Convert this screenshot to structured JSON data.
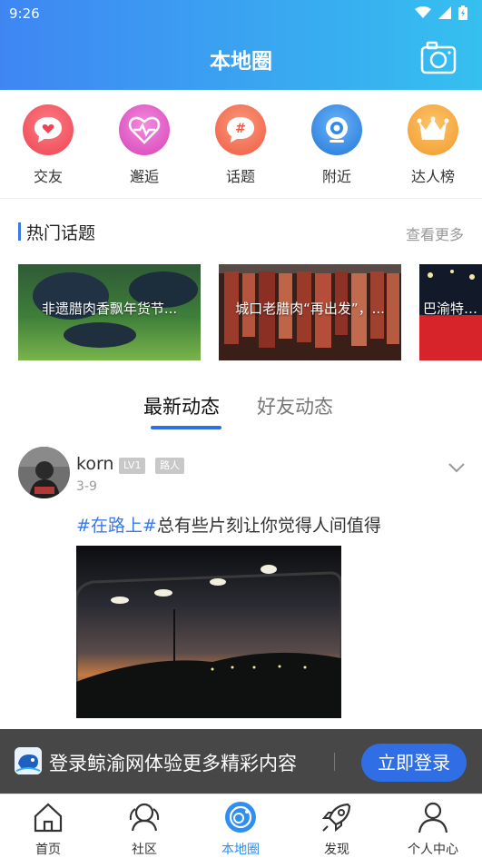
{
  "status_bar": {
    "time": "9:26"
  },
  "header": {
    "title": "本地圈"
  },
  "quick_actions": [
    {
      "label": "交友",
      "icon": "chat-heart-icon",
      "color": "#f04e5a"
    },
    {
      "label": "邂逅",
      "icon": "heartbeat-icon",
      "color": "#e14dc2"
    },
    {
      "label": "话题",
      "icon": "hashtag-icon",
      "color": "#f26a4f"
    },
    {
      "label": "附近",
      "icon": "location-target-icon",
      "color": "#2f8ae8"
    },
    {
      "label": "达人榜",
      "icon": "crown-icon",
      "color": "#f6a33a"
    }
  ],
  "hot_topics": {
    "title": "热门话题",
    "more": "查看更多",
    "items": [
      {
        "caption": "非遗腊肉香飘年货节..."
      },
      {
        "caption": "城口老腊肉“再出发”，..."
      },
      {
        "caption": "巴渝特产..."
      }
    ]
  },
  "feed_tabs": {
    "active": "最新动态",
    "inactive": "好友动态"
  },
  "post": {
    "username": "korn",
    "level": "LV1",
    "title_badge": "路人",
    "date": "3-9",
    "hashtag": "#在路上#",
    "text": "总有些片刻让你觉得人间值得"
  },
  "login_banner": {
    "text": "登录鲸渝网体验更多精彩内容",
    "button": "立即登录"
  },
  "tab_bar": [
    {
      "label": "首页",
      "icon": "home-icon"
    },
    {
      "label": "社区",
      "icon": "community-icon"
    },
    {
      "label": "本地圈",
      "icon": "local-circle-icon",
      "active": true
    },
    {
      "label": "发现",
      "icon": "rocket-icon"
    },
    {
      "label": "个人中心",
      "icon": "user-icon"
    }
  ],
  "colors": {
    "accent": "#2f6ee5",
    "header_start": "#3f86f3",
    "header_end": "#35c0ef",
    "hashtag": "#3b78e7"
  }
}
